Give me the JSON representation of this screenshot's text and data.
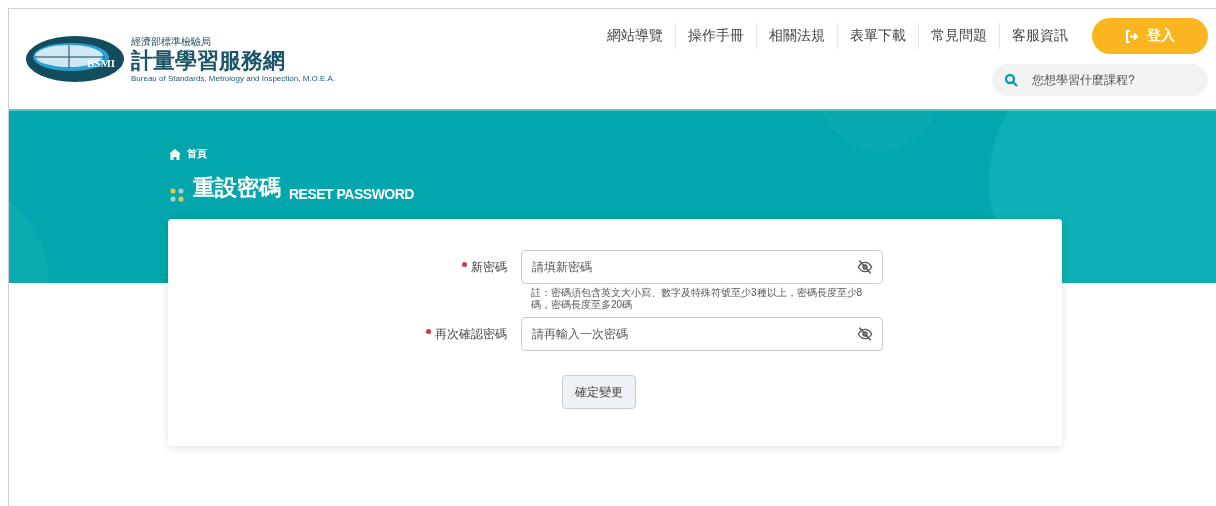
{
  "header": {
    "agency": "經濟部標準檢驗局",
    "site_name": "計量學習服務網",
    "agency_en": "Bureau of Standards, Metrology and Inspection, M.O.E.A.",
    "logo_text": "BSMI",
    "nav": [
      "網站導覽",
      "操作手冊",
      "相關法規",
      "表單下載",
      "常見問題",
      "客服資訊"
    ],
    "login_button": "登入",
    "search": {
      "placeholder": "您想學習什麼課程?"
    }
  },
  "breadcrumb": [
    "首頁"
  ],
  "page_title": {
    "zh": "重設密碼",
    "en": "RESET PASSWORD"
  },
  "form": {
    "fields": [
      {
        "label": "新密碼",
        "required": true,
        "placeholder": "請填新密碼",
        "hint": "註：密碼須包含英文大小寫、數字及特殊符號至少3種以上，密碼長度至少8碼，密碼長度至多20碼"
      },
      {
        "label": "再次確認密碼",
        "required": true,
        "placeholder": "請再輸入一次密碼"
      }
    ],
    "submit": "確定變更"
  }
}
